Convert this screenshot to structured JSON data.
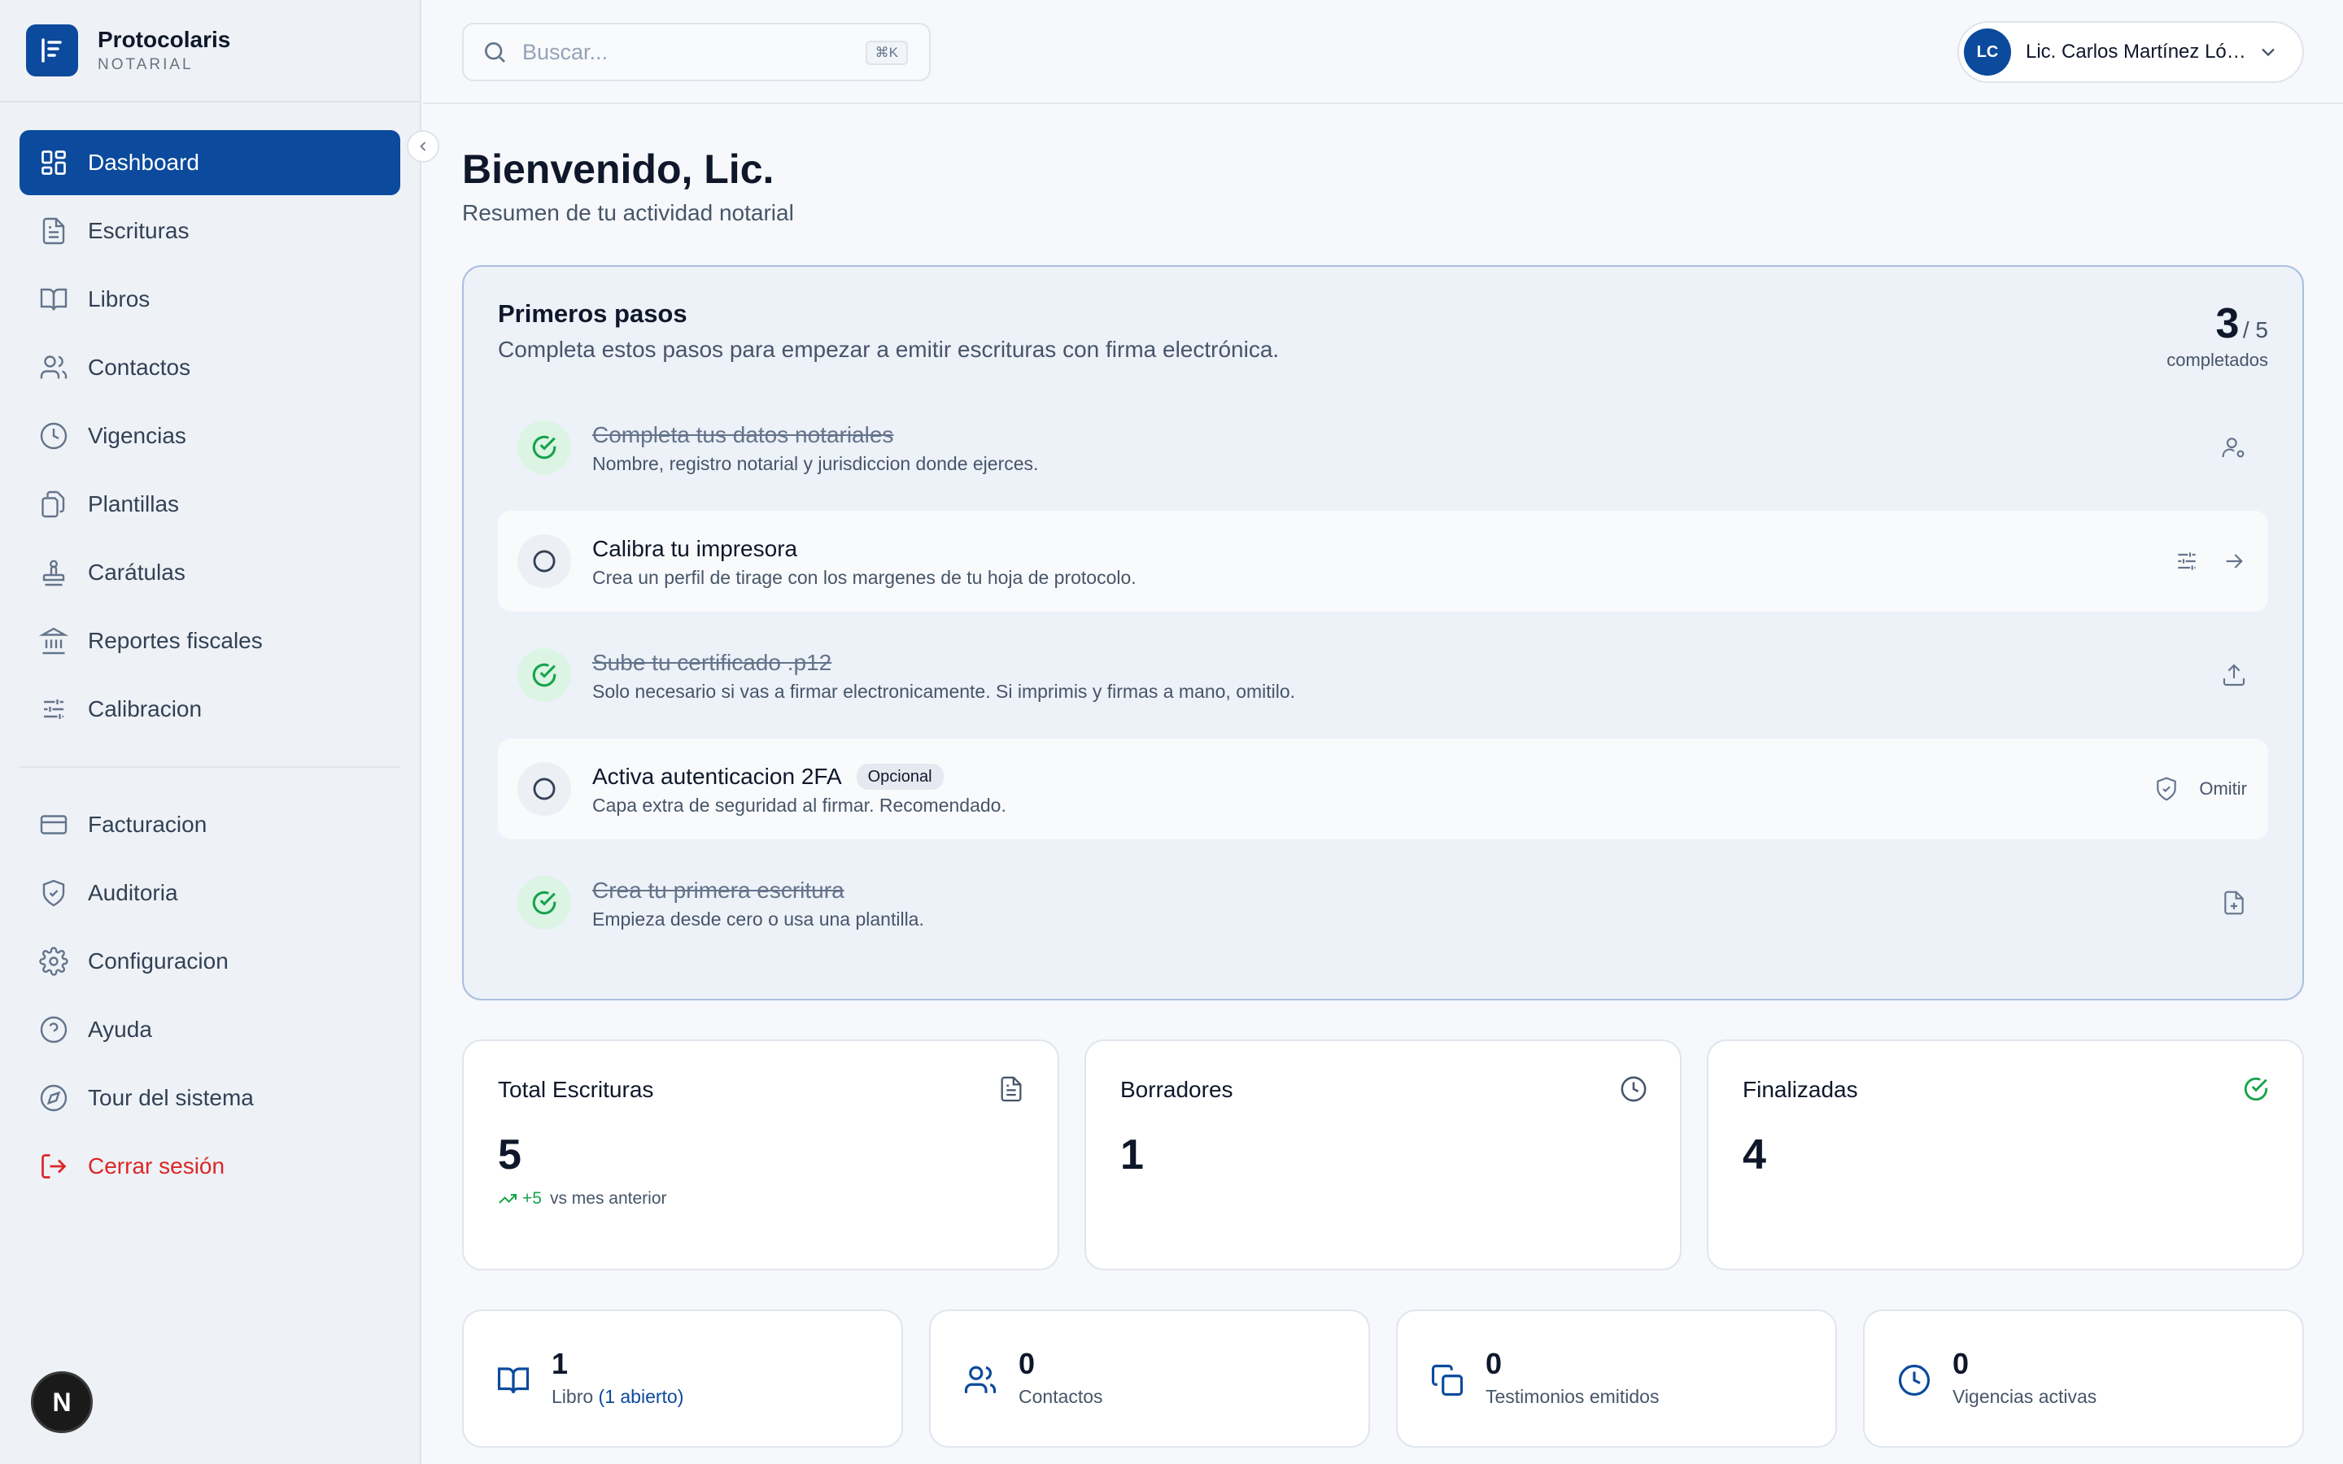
{
  "brand": {
    "name": "Protocolaris",
    "subtitle": "NOTARIAL"
  },
  "sidebar": {
    "items": [
      {
        "label": "Dashboard"
      },
      {
        "label": "Escrituras"
      },
      {
        "label": "Libros"
      },
      {
        "label": "Contactos"
      },
      {
        "label": "Vigencias"
      },
      {
        "label": "Plantillas"
      },
      {
        "label": "Carátulas"
      },
      {
        "label": "Reportes fiscales"
      },
      {
        "label": "Calibracion"
      }
    ],
    "secondary": [
      {
        "label": "Facturacion"
      },
      {
        "label": "Auditoria"
      },
      {
        "label": "Configuracion"
      },
      {
        "label": "Ayuda"
      },
      {
        "label": "Tour del sistema"
      },
      {
        "label": "Cerrar sesión"
      }
    ],
    "next_badge": "N"
  },
  "header": {
    "search_placeholder": "Buscar...",
    "shortcut": "⌘K",
    "user_initials": "LC",
    "user_name": "Lic. Carlos Martínez López"
  },
  "main": {
    "title": "Bienvenido, Lic.",
    "subtitle": "Resumen de tu actividad notarial"
  },
  "steps": {
    "title": "Primeros pasos",
    "description": "Completa estos pasos para empezar a emitir escrituras con firma electrónica.",
    "completed": "3",
    "total": "/ 5",
    "completed_label": "completados",
    "items": [
      {
        "title": "Completa tus datos notariales",
        "desc": "Nombre, registro notarial y jurisdiccion donde ejerces."
      },
      {
        "title": "Calibra tu impresora",
        "desc": "Crea un perfil de tirage con los margenes de tu hoja de protocolo."
      },
      {
        "title": "Sube tu certificado .p12",
        "desc": "Solo necesario si vas a firmar electronicamente. Si imprimis y firmas a mano, omitilo."
      },
      {
        "title": "Activa autenticacion 2FA",
        "badge": "Opcional",
        "desc": "Capa extra de seguridad al firmar. Recomendado.",
        "action": "Omitir"
      },
      {
        "title": "Crea tu primera escritura",
        "desc": "Empieza desde cero o usa una plantilla."
      }
    ]
  },
  "stats": {
    "total": {
      "label": "Total Escrituras",
      "value": "5",
      "delta": "+5",
      "delta_label": "vs mes anterior"
    },
    "drafts": {
      "label": "Borradores",
      "value": "1"
    },
    "final": {
      "label": "Finalizadas",
      "value": "4"
    }
  },
  "mini": {
    "books": {
      "value": "1",
      "label": "Libro",
      "extra": "(1 abierto)"
    },
    "contacts": {
      "value": "0",
      "label": "Contactos"
    },
    "testimonies": {
      "value": "0",
      "label": "Testimonios emitidos"
    },
    "validity": {
      "value": "0",
      "label": "Vigencias activas"
    }
  },
  "colors": {
    "primary": "#0b4a9c",
    "success": "#16a34a",
    "danger": "#dc2626"
  }
}
